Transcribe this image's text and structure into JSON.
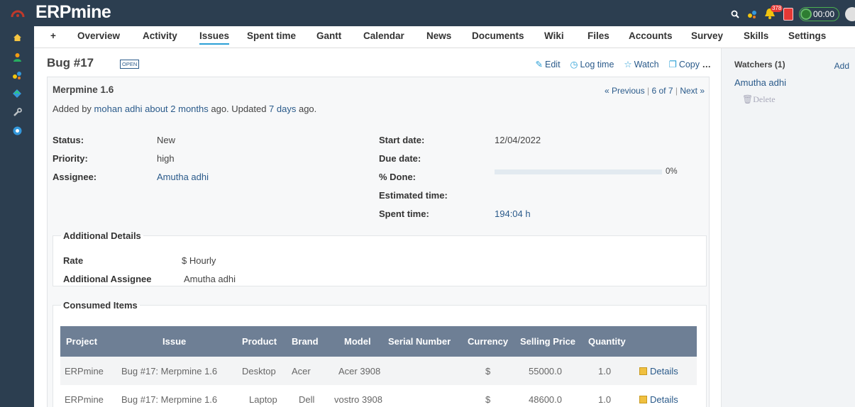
{
  "header": {
    "app_title": "ERPmine",
    "notification_count": "378",
    "timer": "00:00",
    "accent": "#2c3e50"
  },
  "tabs": [
    {
      "label": "+"
    },
    {
      "label": "Overview"
    },
    {
      "label": "Activity"
    },
    {
      "label": "Issues",
      "selected": true
    },
    {
      "label": "Spent time"
    },
    {
      "label": "Gantt"
    },
    {
      "label": "Calendar"
    },
    {
      "label": "News"
    },
    {
      "label": "Documents"
    },
    {
      "label": "Wiki"
    },
    {
      "label": "Files"
    },
    {
      "label": "Accounts"
    },
    {
      "label": "Survey"
    },
    {
      "label": "Skills"
    },
    {
      "label": "Settings"
    }
  ],
  "issue": {
    "title": "Bug #17",
    "status_tag": "OPEN",
    "actions": {
      "edit": "Edit",
      "log_time": "Log time",
      "watch": "Watch",
      "copy": "Copy",
      "more": "…"
    },
    "subject": "Merpmine 1.6",
    "pager": {
      "previous": "« Previous",
      "position": "6 of 7",
      "next": "Next »"
    },
    "author_prefix": "Added by ",
    "author": "mohan adhi",
    "added_ago": "about 2 months",
    "updated_mid": " ago. Updated ",
    "updated_ago": "7 days",
    "updated_suffix": " ago.",
    "attributes": {
      "status_label": "Status:",
      "status": "New",
      "priority_label": "Priority:",
      "priority": "high",
      "assignee_label": "Assignee:",
      "assignee": "Amutha adhi",
      "start_date_label": "Start date:",
      "start_date": "12/04/2022",
      "due_date_label": "Due date:",
      "done_label": "% Done:",
      "done": "0%",
      "done_fraction": 0,
      "estimated_label": "Estimated time:",
      "spent_label": "Spent time:",
      "spent": "194:04 h"
    },
    "additional_details": {
      "legend": "Additional Details",
      "rate_label": "Rate",
      "rate": "$ Hourly",
      "additional_assignee_label": "Additional Assignee",
      "additional_assignee": "Amutha adhi"
    },
    "consumed_items": {
      "legend": "Consumed Items",
      "columns": [
        "Project",
        "Issue",
        "Product",
        "Brand",
        "Model",
        "Serial Number",
        "Currency",
        "Selling Price",
        "Quantity"
      ],
      "rows": [
        {
          "project": "ERPmine",
          "issue": "Bug #17: Merpmine 1.6",
          "product": "Desktop",
          "brand": "Acer",
          "model": "Acer 3908",
          "serial": "",
          "currency": "$",
          "price": "55000.0",
          "quantity": "1.0",
          "details": "Details"
        },
        {
          "project": "ERPmine",
          "issue": "Bug #17: Merpmine 1.6",
          "product": "Laptop",
          "brand": "Dell",
          "model": "vostro 3908",
          "serial": "",
          "currency": "$",
          "price": "48600.0",
          "quantity": "1.0",
          "details": "Details"
        }
      ]
    }
  },
  "sidebar": {
    "watchers_title": "Watchers (1)",
    "add": "Add",
    "watcher": "Amutha adhi",
    "delete": "Delete"
  }
}
